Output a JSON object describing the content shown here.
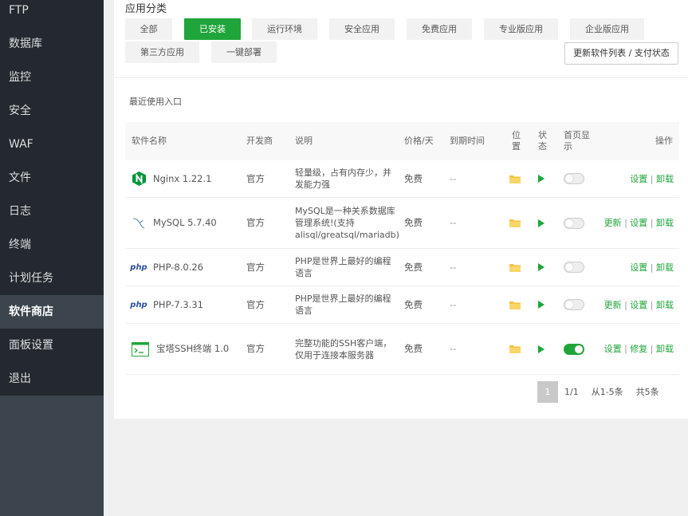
{
  "sidebar": {
    "items": [
      {
        "label": "FTP",
        "active": false
      },
      {
        "label": "数据库",
        "active": false
      },
      {
        "label": "监控",
        "active": false
      },
      {
        "label": "安全",
        "active": false
      },
      {
        "label": "WAF",
        "active": false
      },
      {
        "label": "文件",
        "active": false
      },
      {
        "label": "日志",
        "active": false
      },
      {
        "label": "终端",
        "active": false
      },
      {
        "label": "计划任务",
        "active": false
      },
      {
        "label": "软件商店",
        "active": true
      },
      {
        "label": "面板设置",
        "active": false
      },
      {
        "label": "退出",
        "active": false
      }
    ]
  },
  "categories": {
    "title": "应用分类",
    "buttons": [
      {
        "label": "全部",
        "active": false
      },
      {
        "label": "已安装",
        "active": true
      },
      {
        "label": "运行环境",
        "active": false
      },
      {
        "label": "安全应用",
        "active": false
      },
      {
        "label": "免费应用",
        "active": false
      },
      {
        "label": "专业版应用",
        "active": false
      },
      {
        "label": "企业版应用",
        "active": false
      },
      {
        "label": "第三方应用",
        "active": false
      },
      {
        "label": "一键部署",
        "active": false
      }
    ],
    "update_button": "更新软件列表 / 支付状态"
  },
  "recent_label": "最近使用入口",
  "table": {
    "headers": {
      "name": "软件名称",
      "developer": "开发商",
      "description": "说明",
      "price": "价格/天",
      "expiry": "到期时间",
      "position": "位\n置",
      "status": "状\n态",
      "home_display": "首页显\n示",
      "ops": "操作"
    },
    "rows": [
      {
        "icon": "nginx-icon",
        "name": "Nginx 1.22.1",
        "developer": "官方",
        "description": "轻量级，占有内存少，并发能力强",
        "price": "免费",
        "expiry": "--",
        "home_display": false,
        "ops": [
          "设置",
          "卸载"
        ]
      },
      {
        "icon": "mysql-dolphin-icon",
        "name": "MySQL 5.7.40",
        "developer": "官方",
        "description": "MySQL是一种关系数据库管理系统!(支持alisql/greatsql/mariadb)",
        "price": "免费",
        "expiry": "--",
        "home_display": false,
        "ops": [
          "更新",
          "设置",
          "卸载"
        ]
      },
      {
        "icon": "php-icon",
        "name": "PHP-8.0.26",
        "developer": "官方",
        "description": "PHP是世界上最好的编程语言",
        "price": "免费",
        "expiry": "--",
        "home_display": false,
        "ops": [
          "设置",
          "卸载"
        ]
      },
      {
        "icon": "php-icon",
        "name": "PHP-7.3.31",
        "developer": "官方",
        "description": "PHP是世界上最好的编程语言",
        "price": "免费",
        "expiry": "--",
        "home_display": false,
        "ops": [
          "更新",
          "设置",
          "卸载"
        ]
      },
      {
        "icon": "terminal-icon",
        "name": "宝塔SSH终端 1.0",
        "developer": "官方",
        "description": "完整功能的SSH客户端，仅用于连接本服务器",
        "price": "免费",
        "expiry": "--",
        "home_display": true,
        "ops": [
          "设置",
          "修复",
          "卸载"
        ]
      }
    ]
  },
  "pagination": {
    "current": "1",
    "page_info": "1/1",
    "range": "从1-5条",
    "total": "共5条"
  },
  "colors": {
    "accent": "#20a53a",
    "sidebar_bg": "#23292e",
    "sidebar_active": "#3c444d"
  }
}
